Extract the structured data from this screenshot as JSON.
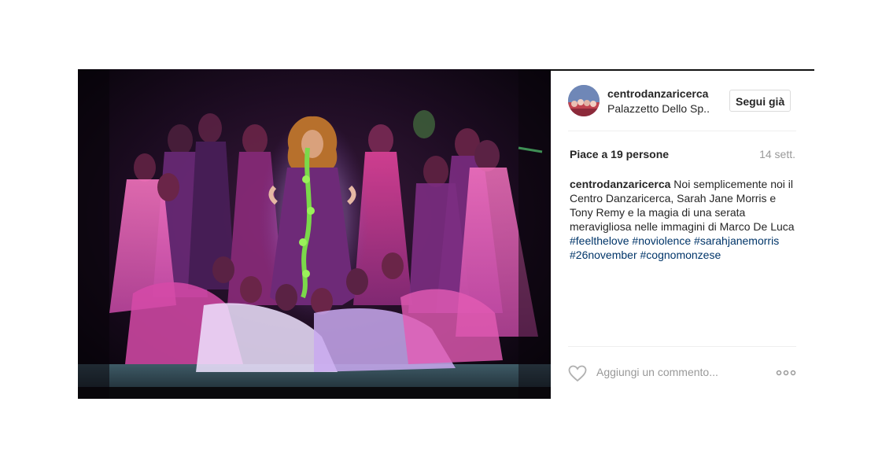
{
  "post": {
    "username": "centrodanzaricerca",
    "location": "Palazzetto Dello Sp..",
    "follow_label": "Segui già",
    "likes": "Piace a 19 persone",
    "date": "14 sett.",
    "caption": {
      "user": "centrodanzaricerca",
      "text": "Noi semplicemente noi il Centro Danzaricerca, Sarah Jane Morris e Tony Remy e la magia di una serata meravigliosa nelle immagini di Marco De Luca",
      "hashtags": [
        "#feelthelove",
        "#noviolence",
        "#sarahjanemorris",
        "#26november",
        "#cognomonzese"
      ]
    },
    "comment_placeholder": "Aggiungi un commento...",
    "icons": {
      "like": "heart-icon",
      "more": "more-options-icon"
    }
  },
  "colors": {
    "text": "#262626",
    "muted": "#999999",
    "hashtag": "#003569",
    "border": "#dbdbdb",
    "divider": "#efefef"
  }
}
